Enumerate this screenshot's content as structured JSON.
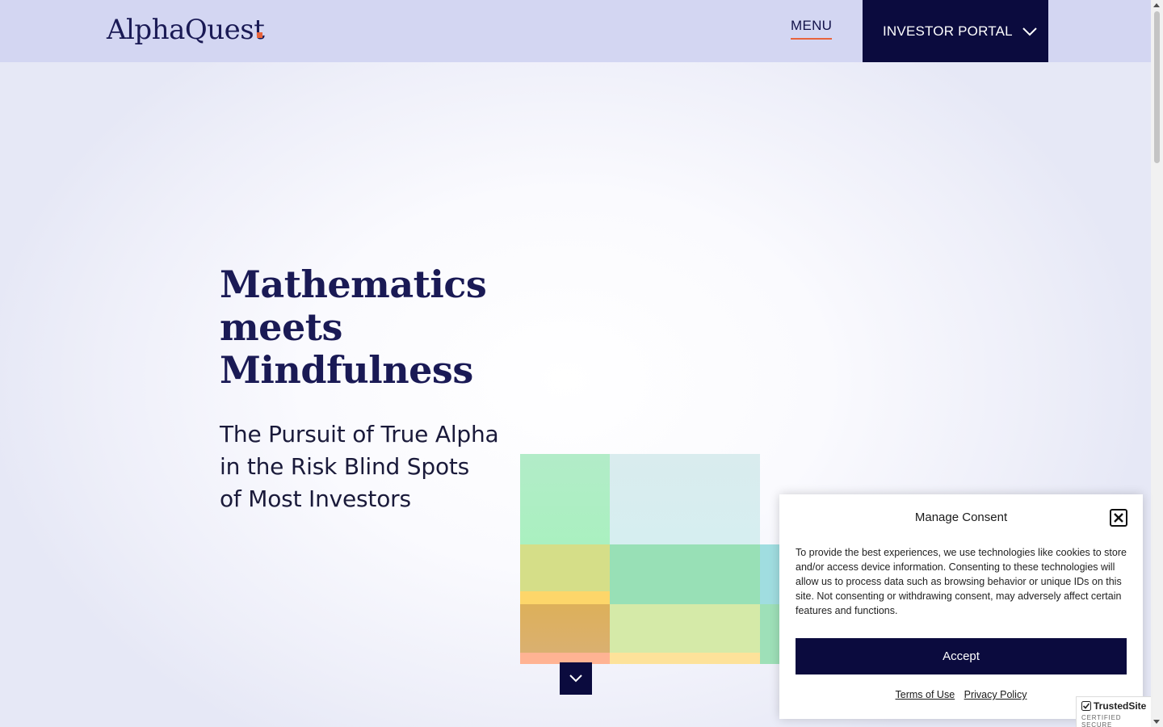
{
  "header": {
    "logo_text": "AlphaQuest",
    "menu_label": "MENU",
    "portal_label": "INVESTOR PORTAL"
  },
  "hero": {
    "title_lines": [
      "Mathematics",
      "meets",
      "Mindfulness"
    ],
    "subtitle_lines": [
      "The Pursuit of True Alpha",
      "in the Risk Blind Spots",
      "of Most Investors"
    ]
  },
  "consent": {
    "title": "Manage Consent",
    "body": "To provide the best experiences, we use technologies like cookies to store and/or access device information. Consenting to these technologies will allow us to process data such as browsing behavior or unique IDs on this site. Not consenting or withdrawing consent, may adversely affect certain features and functions.",
    "accept_label": "Accept",
    "terms_label": "Terms of Use",
    "privacy_label": "Privacy Policy"
  },
  "trust_badge": {
    "name": "TrustedSite",
    "sub": "CERTIFIED SECURE"
  },
  "colors": {
    "accent": "#e8643c",
    "navy": "#0b0b3e",
    "header_bg": "#d3d6f2"
  },
  "icons": {
    "portal_dropdown": "chevron-down-icon",
    "scroll_down": "chevron-down-icon",
    "consent_close": "close-icon",
    "trust_check": "check-icon"
  }
}
